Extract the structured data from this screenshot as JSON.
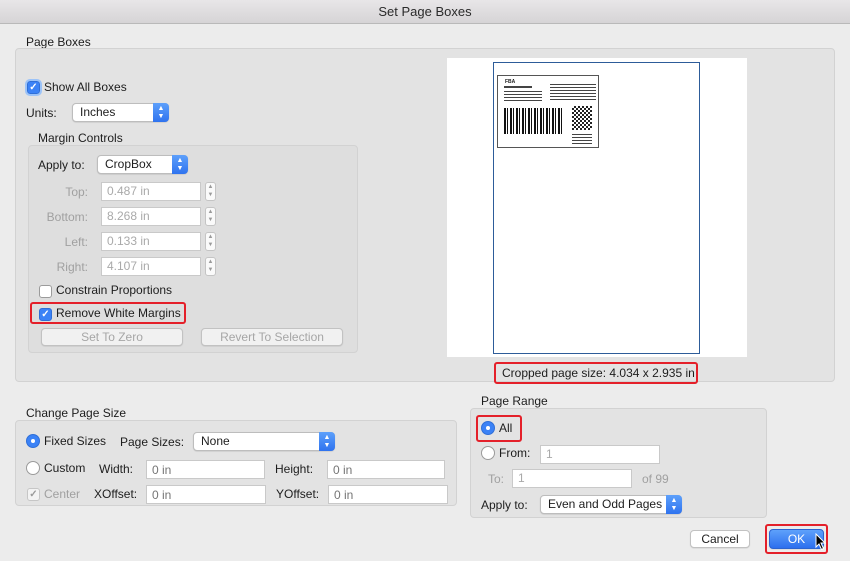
{
  "window": {
    "title": "Set Page Boxes"
  },
  "page_boxes": {
    "label": "Page Boxes",
    "show_all_boxes": "Show All Boxes",
    "units_label": "Units:",
    "units_value": "Inches"
  },
  "margin_controls": {
    "label": "Margin Controls",
    "apply_to_label": "Apply to:",
    "apply_to_value": "CropBox",
    "top_label": "Top:",
    "top_value": "0.487 in",
    "bottom_label": "Bottom:",
    "bottom_value": "8.268 in",
    "left_label": "Left:",
    "left_value": "0.133 in",
    "right_label": "Right:",
    "right_value": "4.107 in",
    "constrain": "Constrain Proportions",
    "remove_white": "Remove White Margins",
    "set_to_zero": "Set To Zero",
    "revert": "Revert To Selection"
  },
  "preview": {
    "cropped_size": "Cropped page size: 4.034 x 2.935 in",
    "label_text": "FBA"
  },
  "change_page_size": {
    "label": "Change Page Size",
    "fixed_sizes": "Fixed Sizes",
    "page_sizes_label": "Page Sizes:",
    "page_sizes_value": "None",
    "custom": "Custom",
    "width_label": "Width:",
    "width_placeholder": "0 in",
    "height_label": "Height:",
    "height_placeholder": "0 in",
    "center": "Center",
    "xoffset_label": "XOffset:",
    "xoffset_placeholder": "0 in",
    "yoffset_label": "YOffset:",
    "yoffset_placeholder": "0 in"
  },
  "page_range": {
    "label": "Page Range",
    "all": "All",
    "from": "From:",
    "from_value": "1",
    "to": "To:",
    "to_value": "1",
    "of": "of 99",
    "apply_to_label": "Apply to:",
    "apply_to_value": "Even and Odd Pages"
  },
  "buttons": {
    "cancel": "Cancel",
    "ok": "OK"
  },
  "colors": {
    "accent": "#3b82f6",
    "highlight": "#e4202a"
  }
}
